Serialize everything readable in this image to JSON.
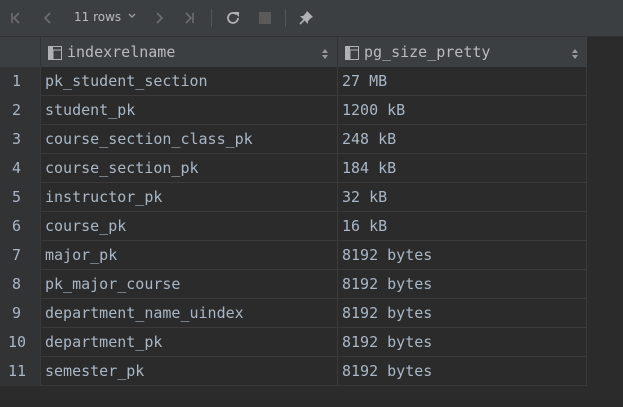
{
  "toolbar": {
    "rows_label": "11 rows",
    "icons": [
      "first-page-icon",
      "prev-page-icon",
      "chevron-down-icon",
      "next-page-icon",
      "last-page-icon",
      "refresh-icon",
      "stop-icon",
      "pin-icon"
    ]
  },
  "columns": [
    {
      "title": "indexrelname"
    },
    {
      "title": "pg_size_pretty"
    }
  ],
  "rows": [
    {
      "num": "1",
      "indexrelname": "pk_student_section",
      "size": "27 MB"
    },
    {
      "num": "2",
      "indexrelname": "student_pk",
      "size": "1200 kB"
    },
    {
      "num": "3",
      "indexrelname": "course_section_class_pk",
      "size": "248 kB"
    },
    {
      "num": "4",
      "indexrelname": "course_section_pk",
      "size": "184 kB"
    },
    {
      "num": "5",
      "indexrelname": "instructor_pk",
      "size": "32 kB"
    },
    {
      "num": "6",
      "indexrelname": "course_pk",
      "size": "16 kB"
    },
    {
      "num": "7",
      "indexrelname": "major_pk",
      "size": "8192 bytes"
    },
    {
      "num": "8",
      "indexrelname": "pk_major_course",
      "size": "8192 bytes"
    },
    {
      "num": "9",
      "indexrelname": "department_name_uindex",
      "size": "8192 bytes"
    },
    {
      "num": "10",
      "indexrelname": "department_pk",
      "size": "8192 bytes"
    },
    {
      "num": "11",
      "indexrelname": "semester_pk",
      "size": "8192 bytes"
    }
  ]
}
